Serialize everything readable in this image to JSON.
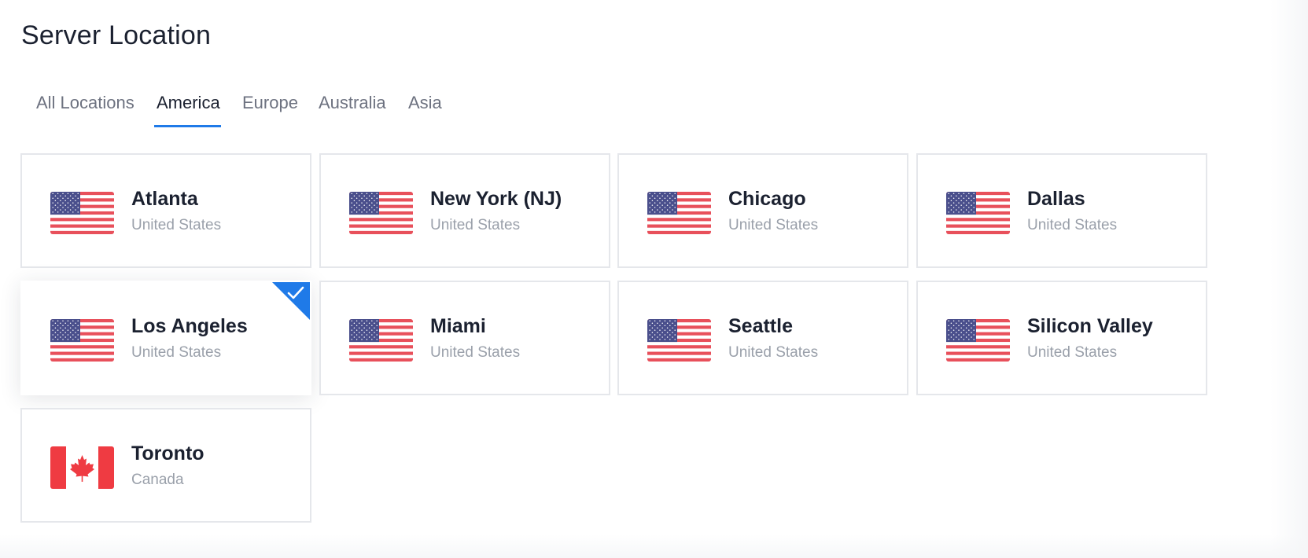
{
  "page": {
    "title": "Server Location"
  },
  "tabs": [
    {
      "label": "All Locations",
      "active": false
    },
    {
      "label": "America",
      "active": true
    },
    {
      "label": "Europe",
      "active": false
    },
    {
      "label": "Australia",
      "active": false
    },
    {
      "label": "Asia",
      "active": false
    }
  ],
  "accent_color": "#1f7ae8",
  "locations": [
    {
      "city": "Atlanta",
      "country": "United States",
      "flag": "us-flag-icon",
      "selected": false
    },
    {
      "city": "New York (NJ)",
      "country": "United States",
      "flag": "us-flag-icon",
      "selected": false
    },
    {
      "city": "Chicago",
      "country": "United States",
      "flag": "us-flag-icon",
      "selected": false
    },
    {
      "city": "Dallas",
      "country": "United States",
      "flag": "us-flag-icon",
      "selected": false
    },
    {
      "city": "Los Angeles",
      "country": "United States",
      "flag": "us-flag-icon",
      "selected": true
    },
    {
      "city": "Miami",
      "country": "United States",
      "flag": "us-flag-icon",
      "selected": false
    },
    {
      "city": "Seattle",
      "country": "United States",
      "flag": "us-flag-icon",
      "selected": false
    },
    {
      "city": "Silicon Valley",
      "country": "United States",
      "flag": "us-flag-icon",
      "selected": false
    },
    {
      "city": "Toronto",
      "country": "Canada",
      "flag": "canada-flag-icon",
      "selected": false
    }
  ]
}
